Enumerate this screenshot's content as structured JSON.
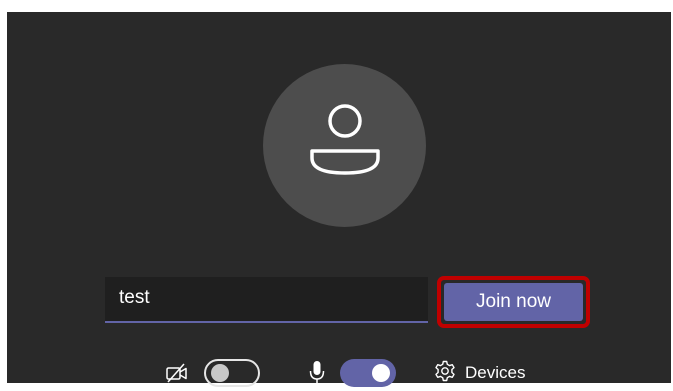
{
  "prejoin": {
    "avatar": {
      "icon": "person-icon"
    },
    "name_input": {
      "value": "test"
    },
    "join_button": {
      "label": "Join now"
    },
    "camera": {
      "icon": "camera-off-icon",
      "enabled": false
    },
    "microphone": {
      "icon": "microphone-icon",
      "enabled": true
    },
    "devices": {
      "icon": "gear-icon",
      "label": "Devices"
    }
  },
  "colors": {
    "background": "#292929",
    "avatar_circle": "#4d4d4d",
    "accent": "#6264a7",
    "highlight_outline": "#c00000"
  }
}
